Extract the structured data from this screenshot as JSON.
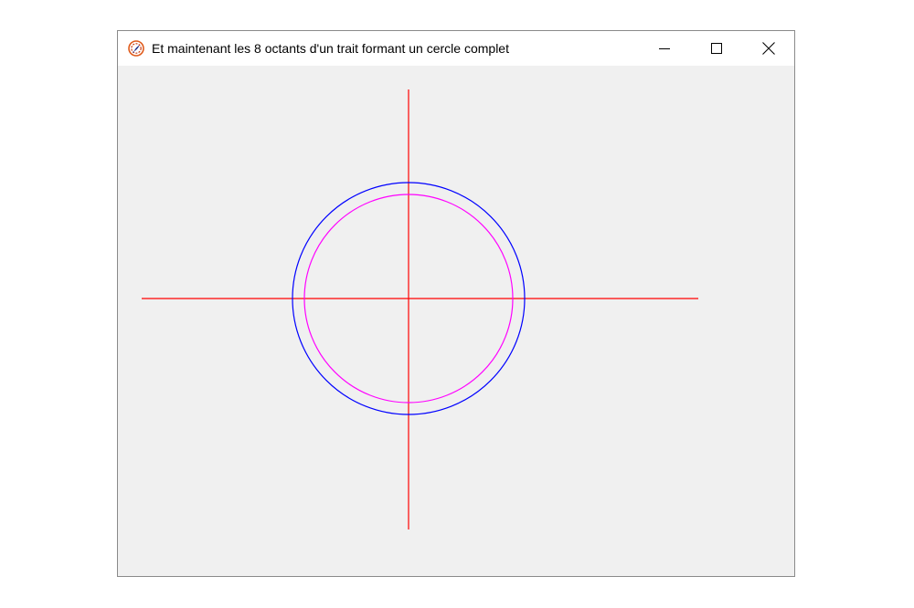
{
  "window": {
    "title": "Et maintenant les 8 octants d'un trait formant un cercle complet",
    "icon": "feather-app-icon",
    "controls": {
      "minimize_icon": "minimize-icon",
      "maximize_icon": "maximize-icon",
      "close_icon": "close-icon"
    }
  },
  "canvas": {
    "background": "#f0f0f0",
    "axes_color": "#ff0000",
    "outer_circle_color": "#0000ff",
    "inner_circle_color": "#ff00ff",
    "outer_radius": 127,
    "inner_radius": 114
  }
}
